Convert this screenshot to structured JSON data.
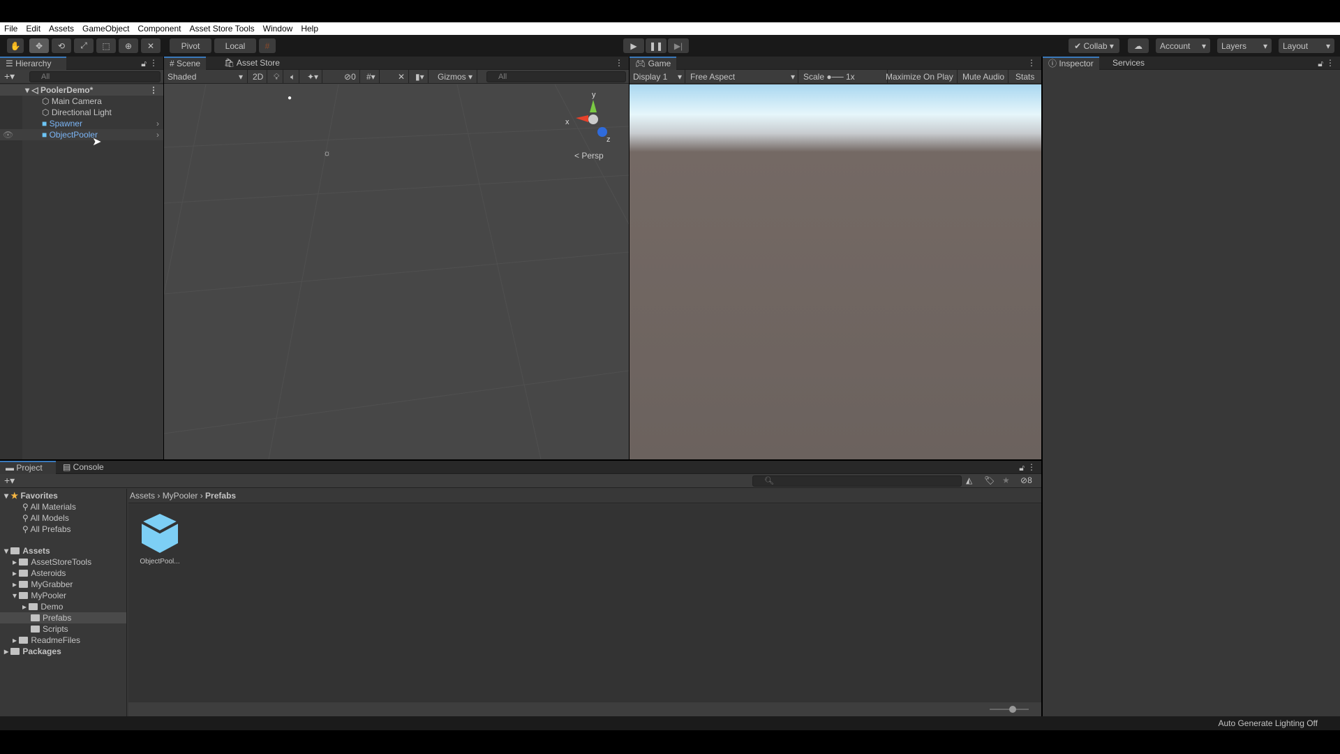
{
  "menu": [
    "File",
    "Edit",
    "Assets",
    "GameObject",
    "Component",
    "Asset Store Tools",
    "Window",
    "Help"
  ],
  "toolbar": {
    "tools": [
      "hand-tool",
      "move-tool",
      "rotate-tool",
      "scale-tool",
      "rect-tool",
      "transform-tool",
      "custom-tool"
    ],
    "pivot": "Pivot",
    "local": "Local",
    "collab": "Collab",
    "account": "Account",
    "layers": "Layers",
    "layout": "Layout"
  },
  "hierarchy": {
    "tab": "Hierarchy",
    "search_placeholder": "All",
    "scene": "PoolerDemo*",
    "items": [
      {
        "label": "Main Camera",
        "type": "gameobject"
      },
      {
        "label": "Directional Light",
        "type": "gameobject"
      },
      {
        "label": "Spawner",
        "type": "prefab"
      },
      {
        "label": "ObjectPooler",
        "type": "prefab"
      }
    ]
  },
  "scene": {
    "tab": "Scene",
    "tab2": "Asset Store",
    "shading": "Shaded",
    "mode2d": "2D",
    "hidden_count": "0",
    "gizmos": "Gizmos",
    "search_placeholder": "All",
    "persp": "Persp",
    "axes": {
      "x": "x",
      "y": "y",
      "z": "z"
    }
  },
  "game": {
    "tab": "Game",
    "display": "Display 1",
    "aspect": "Free Aspect",
    "scale_label": "Scale",
    "scale_value": "1x",
    "maximize": "Maximize On Play",
    "mute": "Mute Audio",
    "stats": "Stats",
    "sky_color": "#cfeefb",
    "ground_color": "#6b625e"
  },
  "inspector": {
    "tab": "Inspector",
    "tab2": "Services"
  },
  "project": {
    "tab": "Project",
    "tab2": "Console",
    "hidden_count": "8",
    "favorites": {
      "label": "Favorites",
      "items": [
        "All Materials",
        "All Models",
        "All Prefabs"
      ]
    },
    "assets": {
      "label": "Assets",
      "items": [
        {
          "label": "AssetStoreTools",
          "depth": 1,
          "expanded": false
        },
        {
          "label": "Asteroids",
          "depth": 1,
          "expanded": false
        },
        {
          "label": "MyGrabber",
          "depth": 1,
          "expanded": false
        },
        {
          "label": "MyPooler",
          "depth": 1,
          "expanded": true
        },
        {
          "label": "Demo",
          "depth": 2,
          "expanded": false
        },
        {
          "label": "Prefabs",
          "depth": 2,
          "selected": true
        },
        {
          "label": "Scripts",
          "depth": 2
        },
        {
          "label": "ReadmeFiles",
          "depth": 1,
          "expanded": false
        }
      ]
    },
    "packages": "Packages",
    "breadcrumb": [
      "Assets",
      "MyPooler",
      "Prefabs"
    ],
    "files": [
      {
        "label": "ObjectPool...",
        "type": "prefab",
        "color": "#7dcff5"
      }
    ]
  },
  "status": {
    "text": "Auto Generate Lighting Off"
  }
}
